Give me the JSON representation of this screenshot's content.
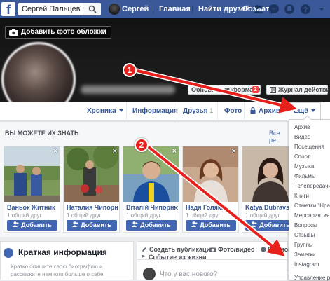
{
  "header": {
    "search_value": "Сергей Пальцев",
    "nav": {
      "user_name": "Сергей",
      "home": "Главная",
      "find_friends": "Найти друзей",
      "create": "Создать"
    },
    "icons": [
      "friends-icon",
      "messenger-icon",
      "notifications-icon",
      "help-icon",
      "account-menu-icon"
    ]
  },
  "cover": {
    "add_cover_label": "Добавить фото обложки",
    "update_info_label": "Обновить информацию",
    "update_badge": "2",
    "activity_log_label": "Журнал действий"
  },
  "tabs": {
    "timeline": "Хроника",
    "about": "Информация",
    "friends": "Друзья",
    "friends_count": "1",
    "photos": "Фото",
    "archive": "Архив",
    "more": "Ещё"
  },
  "pymk": {
    "title": "ВЫ МОЖЕТЕ ИХ ЗНАТЬ",
    "see_all": "Все ре",
    "add_label": "Добавить",
    "people": [
      {
        "name": "Ваньок Житник",
        "mutual": "1 общий друг"
      },
      {
        "name": "Наталия Чипорн...",
        "mutual": "1 общий друг"
      },
      {
        "name": "Віталій Чипорнюк",
        "mutual": "1 общий друг"
      },
      {
        "name": "Надя Голяка",
        "mutual": "1 общий друг"
      },
      {
        "name": "Katya Dubravs",
        "mutual": "1 общий друг"
      }
    ]
  },
  "more_menu": {
    "items": [
      "Архив",
      "Видео",
      "Посещения",
      "Спорт",
      "Музыка",
      "Фильмы",
      "Телепередачи",
      "Книги",
      "Отметки \"Нравится\"",
      "Мероприятия",
      "Вопросы",
      "Отзывы",
      "Группы",
      "Заметки",
      "Instagram"
    ],
    "manage": "Управление разделами"
  },
  "intro": {
    "title": "Краткая информация",
    "text": "Кратко опишите свою биографию и расскажите немного больше о себе"
  },
  "composer": {
    "create_post": "Создать публикацию",
    "photo_video": "Фото/видео",
    "live": "Прямой",
    "life_event": "Событие из жизни",
    "placeholder": "Что у вас нового?"
  },
  "annotations": {
    "step1": "1",
    "step2": "2",
    "arrow_color": "#e8201c"
  }
}
